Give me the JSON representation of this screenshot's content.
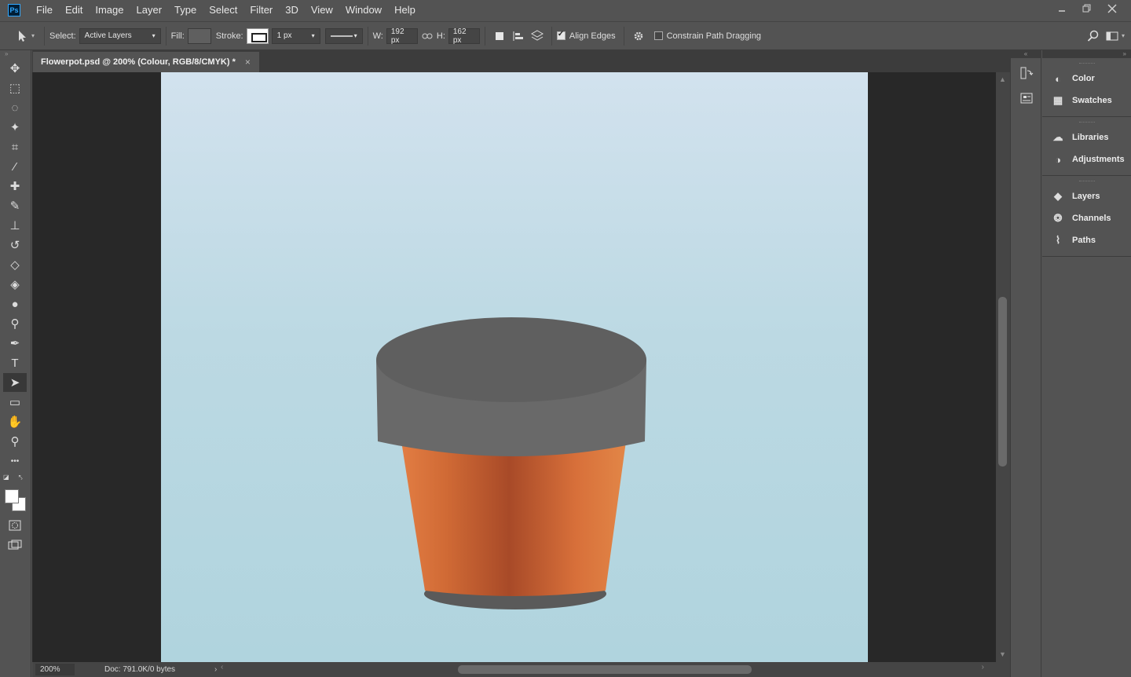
{
  "app": {
    "logo_text": "Ps"
  },
  "menu": [
    "File",
    "Edit",
    "Image",
    "Layer",
    "Type",
    "Select",
    "Filter",
    "3D",
    "View",
    "Window",
    "Help"
  ],
  "options": {
    "select_label": "Select:",
    "select_value": "Active Layers",
    "fill_label": "Fill:",
    "stroke_label": "Stroke:",
    "stroke_width": "1 px",
    "w_label": "W:",
    "w_value": "192 px",
    "h_label": "H:",
    "h_value": "162 px",
    "align_edges_label": "Align Edges",
    "align_edges_checked": true,
    "constrain_label": "Constrain Path Dragging",
    "constrain_checked": false
  },
  "document": {
    "tab_title": "Flowerpot.psd @ 200% (Colour, RGB/8/CMYK) *",
    "close_glyph": "×"
  },
  "status": {
    "zoom": "200%",
    "doc_info": "Doc: 791.0K/0 bytes"
  },
  "tools": [
    {
      "name": "move-tool",
      "icon": "move-icon",
      "glyph": "✥"
    },
    {
      "name": "marquee-tool",
      "icon": "rect-marquee-icon",
      "glyph": "⬚"
    },
    {
      "name": "lasso-tool",
      "icon": "lasso-icon",
      "glyph": "◌"
    },
    {
      "name": "magic-wand-tool",
      "icon": "magic-wand-icon",
      "glyph": "✦"
    },
    {
      "name": "crop-tool",
      "icon": "crop-icon",
      "glyph": "⌗"
    },
    {
      "name": "eyedropper-tool",
      "icon": "eyedropper-icon",
      "glyph": "⁄"
    },
    {
      "name": "healing-brush-tool",
      "icon": "bandage-icon",
      "glyph": "✚"
    },
    {
      "name": "brush-tool",
      "icon": "brush-icon",
      "glyph": "✎"
    },
    {
      "name": "clone-stamp-tool",
      "icon": "stamp-icon",
      "glyph": "⊥"
    },
    {
      "name": "history-brush-tool",
      "icon": "history-brush-icon",
      "glyph": "↺"
    },
    {
      "name": "eraser-tool",
      "icon": "eraser-icon",
      "glyph": "◇"
    },
    {
      "name": "paint-bucket-tool",
      "icon": "bucket-icon",
      "glyph": "◈"
    },
    {
      "name": "blur-tool",
      "icon": "drop-icon",
      "glyph": "●"
    },
    {
      "name": "dodge-tool",
      "icon": "dodge-icon",
      "glyph": "⚲"
    },
    {
      "name": "pen-tool",
      "icon": "pen-icon",
      "glyph": "✒"
    },
    {
      "name": "type-tool",
      "icon": "type-icon",
      "glyph": "T"
    },
    {
      "name": "path-selection-tool",
      "icon": "arrow-icon",
      "glyph": "➤"
    },
    {
      "name": "rectangle-tool",
      "icon": "rectangle-icon",
      "glyph": "▭"
    },
    {
      "name": "hand-tool",
      "icon": "hand-icon",
      "glyph": "✋"
    },
    {
      "name": "zoom-tool",
      "icon": "zoom-icon",
      "glyph": "⚲"
    },
    {
      "name": "more-tools",
      "icon": "ellipsis-icon",
      "glyph": "•••"
    }
  ],
  "panels": {
    "group1": [
      {
        "label": "Color",
        "icon": "color-icon",
        "glyph": "◐"
      },
      {
        "label": "Swatches",
        "icon": "swatches-icon",
        "glyph": "▦"
      }
    ],
    "group2": [
      {
        "label": "Libraries",
        "icon": "libraries-icon",
        "glyph": "☁"
      },
      {
        "label": "Adjustments",
        "icon": "adjustments-icon",
        "glyph": "◑"
      }
    ],
    "group3": [
      {
        "label": "Layers",
        "icon": "layers-icon",
        "glyph": "◆"
      },
      {
        "label": "Channels",
        "icon": "channels-icon",
        "glyph": "❂"
      },
      {
        "label": "Paths",
        "icon": "paths-icon",
        "glyph": "⌇"
      }
    ]
  },
  "colors": {
    "pot_rim": "#5f5f5f",
    "pot_rim_side": "#696969",
    "pot_body_light": "#e07a3c",
    "pot_body_dark": "#a84a26",
    "pot_base": "#5a5a5a",
    "canvas_top": "#d2e2ee",
    "canvas_bottom": "#b0d4de"
  }
}
